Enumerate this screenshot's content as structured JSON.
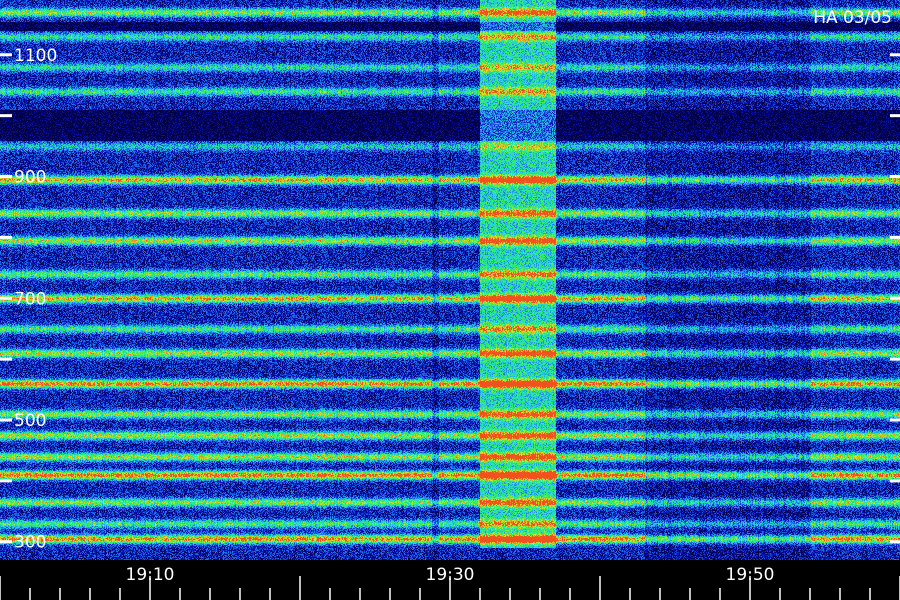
{
  "chart_data": {
    "type": "heatmap",
    "title": "HA 03/05",
    "xlabel": "",
    "ylabel": "",
    "x_range": [
      "19:00",
      "20:00"
    ],
    "x_ticks": [
      "19:10",
      "19:30",
      "19:50"
    ],
    "y_range": [
      270,
      1190
    ],
    "y_ticks": [
      300,
      500,
      700,
      900,
      1100
    ],
    "y_minor_ticks": [
      400,
      600,
      800,
      1000
    ],
    "colormap": [
      "#00004a",
      "#0a14b4",
      "#1e6ef0",
      "#23d2d2",
      "#32f064",
      "#d2e628",
      "#f0501e"
    ],
    "background": "#000000",
    "bright_bands": [
      {
        "center": 305,
        "intensity": 0.78
      },
      {
        "center": 330,
        "intensity": 0.45
      },
      {
        "center": 365,
        "intensity": 0.55
      },
      {
        "center": 410,
        "intensity": 0.82
      },
      {
        "center": 440,
        "intensity": 0.6
      },
      {
        "center": 475,
        "intensity": 0.6
      },
      {
        "center": 510,
        "intensity": 0.55
      },
      {
        "center": 560,
        "intensity": 0.8
      },
      {
        "center": 610,
        "intensity": 0.6
      },
      {
        "center": 650,
        "intensity": 0.45
      },
      {
        "center": 700,
        "intensity": 0.72
      },
      {
        "center": 740,
        "intensity": 0.48
      },
      {
        "center": 795,
        "intensity": 0.6
      },
      {
        "center": 840,
        "intensity": 0.55
      },
      {
        "center": 895,
        "intensity": 0.72
      },
      {
        "center": 950,
        "intensity": 0.3
      },
      {
        "center": 1040,
        "intensity": 0.42
      },
      {
        "center": 1080,
        "intensity": 0.38
      },
      {
        "center": 1130,
        "intensity": 0.4
      },
      {
        "center": 1170,
        "intensity": 0.55
      }
    ],
    "dark_bands": [
      {
        "from": 960,
        "to": 1010
      },
      {
        "from": 1140,
        "to": 1155
      }
    ],
    "burst": {
      "from": "19:32",
      "to": "19:37",
      "low": 290,
      "high": 1190,
      "intensity": 0.35
    },
    "quiet_period": {
      "from": "19:43",
      "to": "19:54",
      "intensity": -0.3
    },
    "gaps": [
      "19:29"
    ]
  }
}
